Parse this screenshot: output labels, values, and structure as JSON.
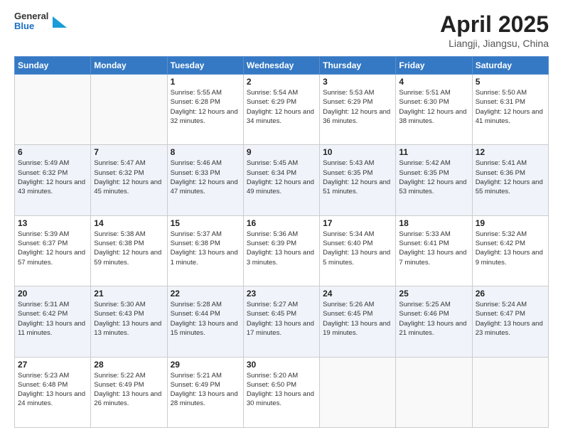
{
  "header": {
    "logo_general": "General",
    "logo_blue": "Blue",
    "month_year": "April 2025",
    "location": "Liangji, Jiangsu, China"
  },
  "days_of_week": [
    "Sunday",
    "Monday",
    "Tuesday",
    "Wednesday",
    "Thursday",
    "Friday",
    "Saturday"
  ],
  "weeks": [
    [
      {
        "day": "",
        "sunrise": "",
        "sunset": "",
        "daylight": ""
      },
      {
        "day": "",
        "sunrise": "",
        "sunset": "",
        "daylight": ""
      },
      {
        "day": "1",
        "sunrise": "Sunrise: 5:55 AM",
        "sunset": "Sunset: 6:28 PM",
        "daylight": "Daylight: 12 hours and 32 minutes."
      },
      {
        "day": "2",
        "sunrise": "Sunrise: 5:54 AM",
        "sunset": "Sunset: 6:29 PM",
        "daylight": "Daylight: 12 hours and 34 minutes."
      },
      {
        "day": "3",
        "sunrise": "Sunrise: 5:53 AM",
        "sunset": "Sunset: 6:29 PM",
        "daylight": "Daylight: 12 hours and 36 minutes."
      },
      {
        "day": "4",
        "sunrise": "Sunrise: 5:51 AM",
        "sunset": "Sunset: 6:30 PM",
        "daylight": "Daylight: 12 hours and 38 minutes."
      },
      {
        "day": "5",
        "sunrise": "Sunrise: 5:50 AM",
        "sunset": "Sunset: 6:31 PM",
        "daylight": "Daylight: 12 hours and 41 minutes."
      }
    ],
    [
      {
        "day": "6",
        "sunrise": "Sunrise: 5:49 AM",
        "sunset": "Sunset: 6:32 PM",
        "daylight": "Daylight: 12 hours and 43 minutes."
      },
      {
        "day": "7",
        "sunrise": "Sunrise: 5:47 AM",
        "sunset": "Sunset: 6:32 PM",
        "daylight": "Daylight: 12 hours and 45 minutes."
      },
      {
        "day": "8",
        "sunrise": "Sunrise: 5:46 AM",
        "sunset": "Sunset: 6:33 PM",
        "daylight": "Daylight: 12 hours and 47 minutes."
      },
      {
        "day": "9",
        "sunrise": "Sunrise: 5:45 AM",
        "sunset": "Sunset: 6:34 PM",
        "daylight": "Daylight: 12 hours and 49 minutes."
      },
      {
        "day": "10",
        "sunrise": "Sunrise: 5:43 AM",
        "sunset": "Sunset: 6:35 PM",
        "daylight": "Daylight: 12 hours and 51 minutes."
      },
      {
        "day": "11",
        "sunrise": "Sunrise: 5:42 AM",
        "sunset": "Sunset: 6:35 PM",
        "daylight": "Daylight: 12 hours and 53 minutes."
      },
      {
        "day": "12",
        "sunrise": "Sunrise: 5:41 AM",
        "sunset": "Sunset: 6:36 PM",
        "daylight": "Daylight: 12 hours and 55 minutes."
      }
    ],
    [
      {
        "day": "13",
        "sunrise": "Sunrise: 5:39 AM",
        "sunset": "Sunset: 6:37 PM",
        "daylight": "Daylight: 12 hours and 57 minutes."
      },
      {
        "day": "14",
        "sunrise": "Sunrise: 5:38 AM",
        "sunset": "Sunset: 6:38 PM",
        "daylight": "Daylight: 12 hours and 59 minutes."
      },
      {
        "day": "15",
        "sunrise": "Sunrise: 5:37 AM",
        "sunset": "Sunset: 6:38 PM",
        "daylight": "Daylight: 13 hours and 1 minute."
      },
      {
        "day": "16",
        "sunrise": "Sunrise: 5:36 AM",
        "sunset": "Sunset: 6:39 PM",
        "daylight": "Daylight: 13 hours and 3 minutes."
      },
      {
        "day": "17",
        "sunrise": "Sunrise: 5:34 AM",
        "sunset": "Sunset: 6:40 PM",
        "daylight": "Daylight: 13 hours and 5 minutes."
      },
      {
        "day": "18",
        "sunrise": "Sunrise: 5:33 AM",
        "sunset": "Sunset: 6:41 PM",
        "daylight": "Daylight: 13 hours and 7 minutes."
      },
      {
        "day": "19",
        "sunrise": "Sunrise: 5:32 AM",
        "sunset": "Sunset: 6:42 PM",
        "daylight": "Daylight: 13 hours and 9 minutes."
      }
    ],
    [
      {
        "day": "20",
        "sunrise": "Sunrise: 5:31 AM",
        "sunset": "Sunset: 6:42 PM",
        "daylight": "Daylight: 13 hours and 11 minutes."
      },
      {
        "day": "21",
        "sunrise": "Sunrise: 5:30 AM",
        "sunset": "Sunset: 6:43 PM",
        "daylight": "Daylight: 13 hours and 13 minutes."
      },
      {
        "day": "22",
        "sunrise": "Sunrise: 5:28 AM",
        "sunset": "Sunset: 6:44 PM",
        "daylight": "Daylight: 13 hours and 15 minutes."
      },
      {
        "day": "23",
        "sunrise": "Sunrise: 5:27 AM",
        "sunset": "Sunset: 6:45 PM",
        "daylight": "Daylight: 13 hours and 17 minutes."
      },
      {
        "day": "24",
        "sunrise": "Sunrise: 5:26 AM",
        "sunset": "Sunset: 6:45 PM",
        "daylight": "Daylight: 13 hours and 19 minutes."
      },
      {
        "day": "25",
        "sunrise": "Sunrise: 5:25 AM",
        "sunset": "Sunset: 6:46 PM",
        "daylight": "Daylight: 13 hours and 21 minutes."
      },
      {
        "day": "26",
        "sunrise": "Sunrise: 5:24 AM",
        "sunset": "Sunset: 6:47 PM",
        "daylight": "Daylight: 13 hours and 23 minutes."
      }
    ],
    [
      {
        "day": "27",
        "sunrise": "Sunrise: 5:23 AM",
        "sunset": "Sunset: 6:48 PM",
        "daylight": "Daylight: 13 hours and 24 minutes."
      },
      {
        "day": "28",
        "sunrise": "Sunrise: 5:22 AM",
        "sunset": "Sunset: 6:49 PM",
        "daylight": "Daylight: 13 hours and 26 minutes."
      },
      {
        "day": "29",
        "sunrise": "Sunrise: 5:21 AM",
        "sunset": "Sunset: 6:49 PM",
        "daylight": "Daylight: 13 hours and 28 minutes."
      },
      {
        "day": "30",
        "sunrise": "Sunrise: 5:20 AM",
        "sunset": "Sunset: 6:50 PM",
        "daylight": "Daylight: 13 hours and 30 minutes."
      },
      {
        "day": "",
        "sunrise": "",
        "sunset": "",
        "daylight": ""
      },
      {
        "day": "",
        "sunrise": "",
        "sunset": "",
        "daylight": ""
      },
      {
        "day": "",
        "sunrise": "",
        "sunset": "",
        "daylight": ""
      }
    ]
  ]
}
